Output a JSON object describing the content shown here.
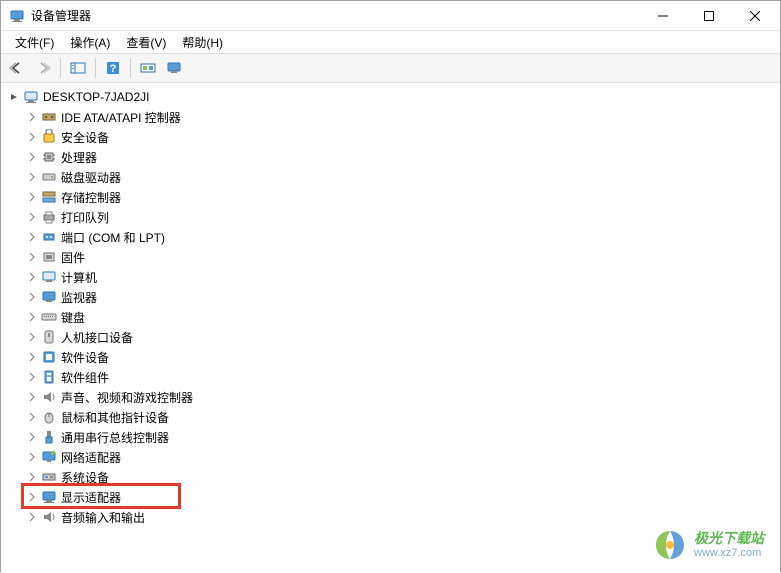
{
  "window": {
    "title": "设备管理器"
  },
  "menu": {
    "file": "文件(F)",
    "action": "操作(A)",
    "view": "查看(V)",
    "help": "帮助(H)"
  },
  "tree": {
    "root": "DESKTOP-7JAD2JI",
    "items": [
      {
        "label": "IDE ATA/ATAPI 控制器",
        "icon": "ide"
      },
      {
        "label": "安全设备",
        "icon": "security"
      },
      {
        "label": "处理器",
        "icon": "cpu"
      },
      {
        "label": "磁盘驱动器",
        "icon": "disk"
      },
      {
        "label": "存储控制器",
        "icon": "storage"
      },
      {
        "label": "打印队列",
        "icon": "printer"
      },
      {
        "label": "端口 (COM 和 LPT)",
        "icon": "port"
      },
      {
        "label": "固件",
        "icon": "firmware"
      },
      {
        "label": "计算机",
        "icon": "computer"
      },
      {
        "label": "监视器",
        "icon": "monitor"
      },
      {
        "label": "键盘",
        "icon": "keyboard"
      },
      {
        "label": "人机接口设备",
        "icon": "hid"
      },
      {
        "label": "软件设备",
        "icon": "software"
      },
      {
        "label": "软件组件",
        "icon": "component"
      },
      {
        "label": "声音、视频和游戏控制器",
        "icon": "audio"
      },
      {
        "label": "鼠标和其他指针设备",
        "icon": "mouse"
      },
      {
        "label": "通用串行总线控制器",
        "icon": "usb"
      },
      {
        "label": "网络适配器",
        "icon": "network"
      },
      {
        "label": "系统设备",
        "icon": "system"
      },
      {
        "label": "显示适配器",
        "icon": "display"
      },
      {
        "label": "音频输入和输出",
        "icon": "audioio"
      }
    ]
  },
  "watermark": {
    "name": "极光下载站",
    "url": "www.xz7.com"
  },
  "highlighted_index": 19
}
